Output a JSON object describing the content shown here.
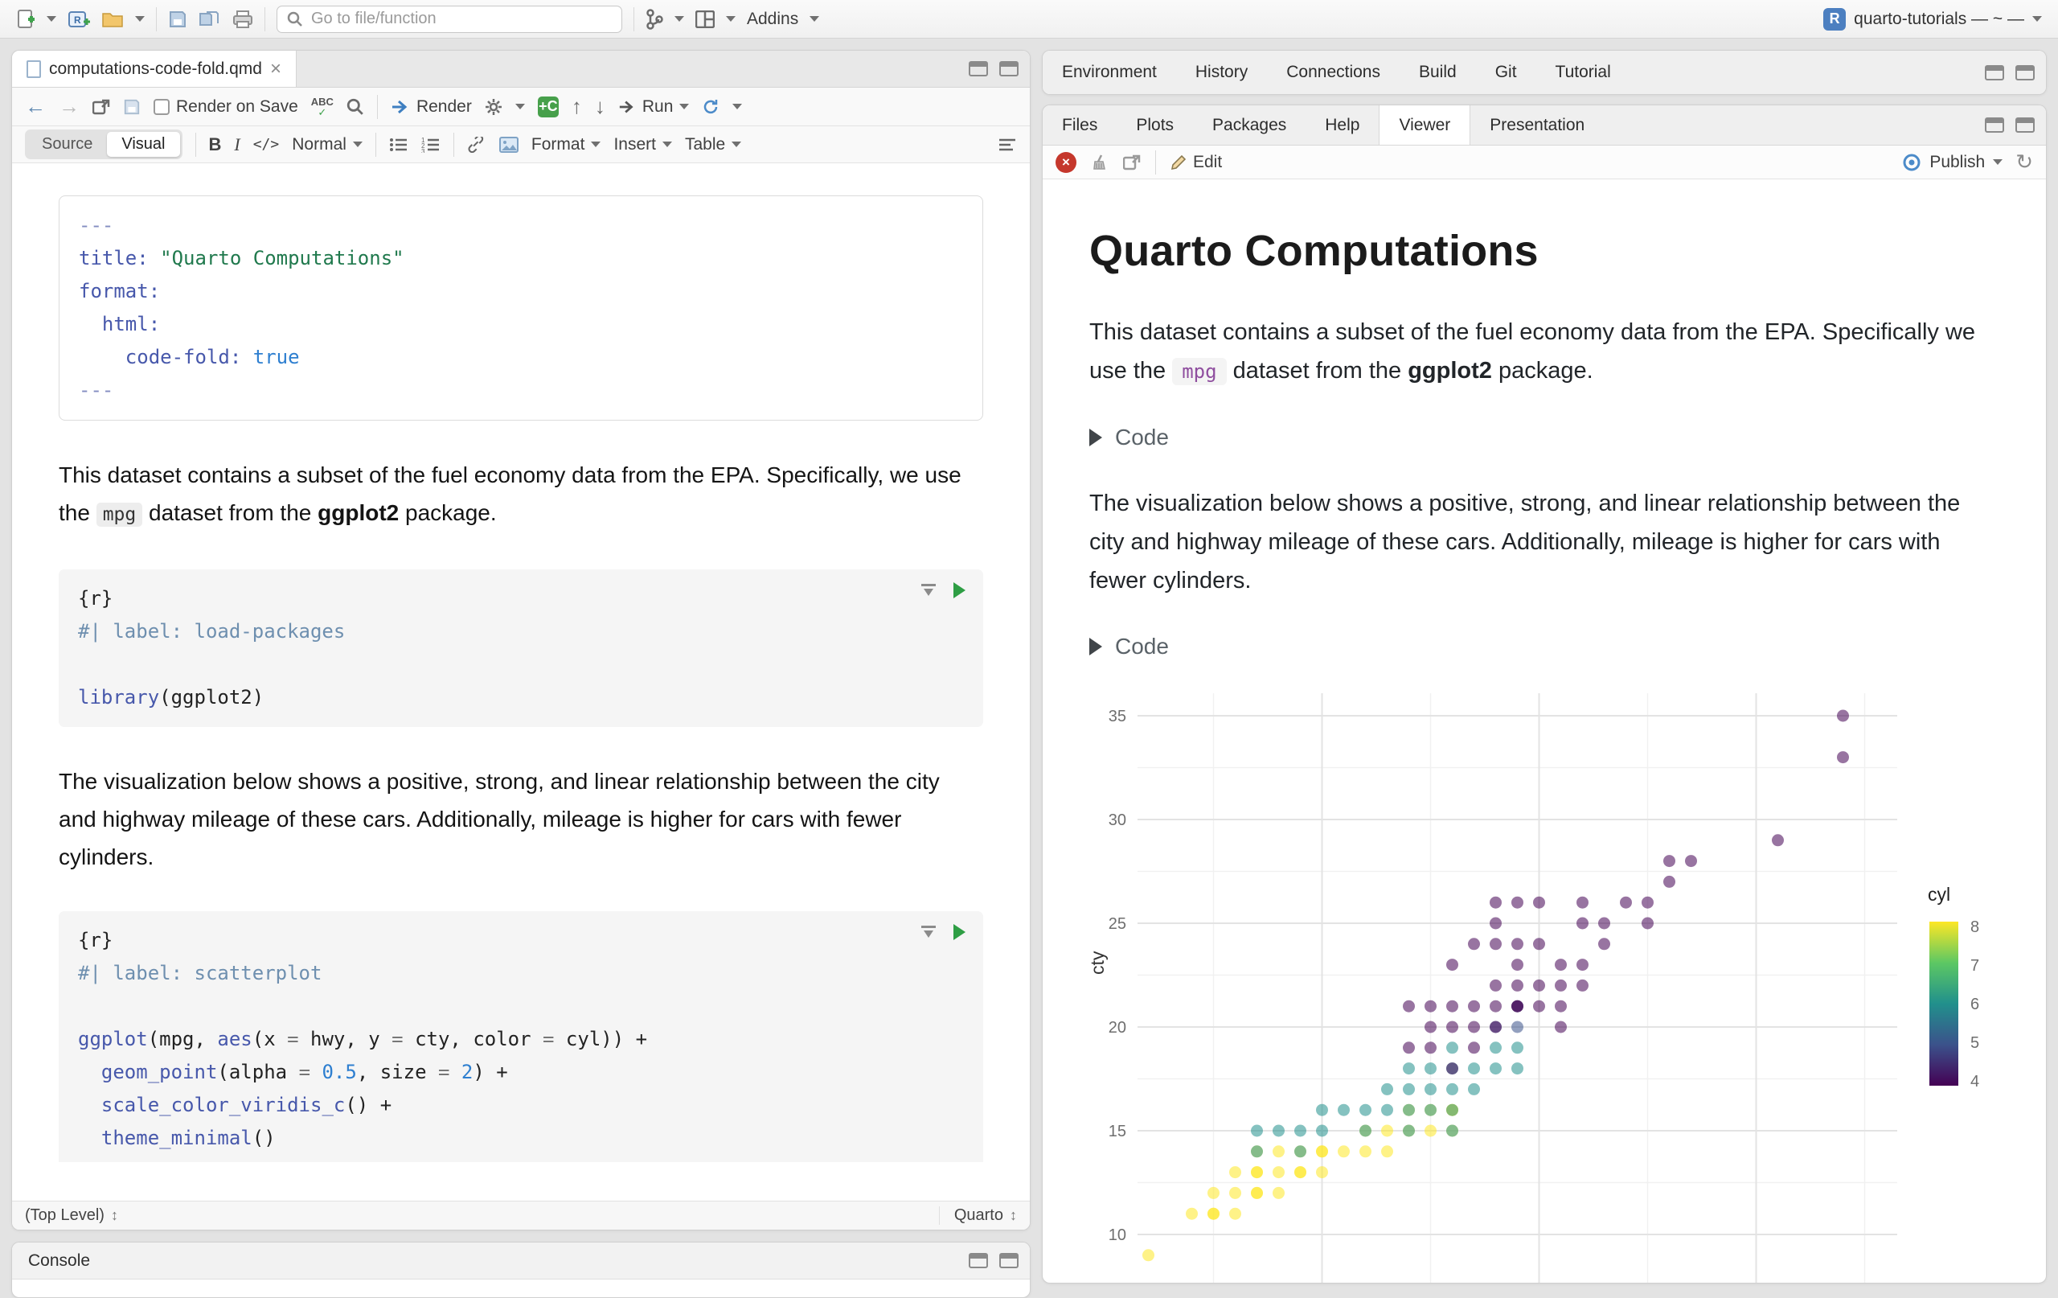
{
  "titlebar": {
    "goto_placeholder": "Go to file/function",
    "addins_label": "Addins",
    "project_label": "quarto-tutorials — ~ —"
  },
  "source_pane": {
    "tab_title": "computations-code-fold.qmd",
    "close_glyph": "×",
    "toolbar": {
      "render_on_save": "Render on Save",
      "render": "Render",
      "run": "Run"
    },
    "format_toolbar": {
      "source": "Source",
      "visual": "Visual",
      "bold": "B",
      "italic": "I",
      "code": "</>",
      "paragraph_style": "Normal",
      "format": "Format",
      "insert": "Insert",
      "table": "Table"
    },
    "yaml_lines": [
      [
        [
          "de",
          "---"
        ]
      ],
      [
        [
          "kw",
          "title:"
        ],
        [
          "pl",
          " "
        ],
        [
          "str",
          "\"Quarto Computations\""
        ]
      ],
      [
        [
          "kw",
          "format:"
        ]
      ],
      [
        [
          "pl",
          "  "
        ],
        [
          "kw",
          "html:"
        ]
      ],
      [
        [
          "pl",
          "    "
        ],
        [
          "kw",
          "code-fold:"
        ],
        [
          "pl",
          " "
        ],
        [
          "num",
          "true"
        ]
      ],
      [
        [
          "de",
          "---"
        ]
      ]
    ],
    "p1": {
      "a": "This dataset contains a subset of the fuel economy data from the EPA. Specifically, we use the ",
      "code": "mpg",
      "b": " dataset from the ",
      "bold": "ggplot2",
      "c": " package."
    },
    "chunk1_lines": [
      [
        [
          "pl",
          "{r}"
        ]
      ],
      [
        [
          "cm",
          "#| label: load-packages"
        ]
      ],
      [],
      [
        [
          "kw",
          "library"
        ],
        [
          "pl",
          "(ggplot2)"
        ]
      ]
    ],
    "p2": "The visualization below shows a positive, strong, and linear relationship between the city and highway mileage of these cars. Additionally, mileage is higher for cars with fewer cylinders.",
    "chunk2_lines": [
      [
        [
          "pl",
          "{r}"
        ]
      ],
      [
        [
          "cm",
          "#| label: scatterplot"
        ]
      ],
      [],
      [
        [
          "kw",
          "ggplot"
        ],
        [
          "pl",
          "(mpg, "
        ],
        [
          "kw",
          "aes"
        ],
        [
          "pl",
          "(x "
        ],
        [
          "op",
          "="
        ],
        [
          "pl",
          " hwy, y "
        ],
        [
          "op",
          "="
        ],
        [
          "pl",
          " cty, color "
        ],
        [
          "op",
          "="
        ],
        [
          "pl",
          " cyl)) +"
        ]
      ],
      [
        [
          "pl",
          "  "
        ],
        [
          "kw",
          "geom_point"
        ],
        [
          "pl",
          "(alpha "
        ],
        [
          "op",
          "="
        ],
        [
          "pl",
          " "
        ],
        [
          "num",
          "0.5"
        ],
        [
          "pl",
          ", size "
        ],
        [
          "op",
          "="
        ],
        [
          "pl",
          " "
        ],
        [
          "num",
          "2"
        ],
        [
          "pl",
          ") +"
        ]
      ],
      [
        [
          "pl",
          "  "
        ],
        [
          "kw",
          "scale_color_viridis_c"
        ],
        [
          "pl",
          "() +"
        ]
      ],
      [
        [
          "pl",
          "  "
        ],
        [
          "kw",
          "theme_minimal"
        ],
        [
          "pl",
          "()"
        ]
      ]
    ],
    "status_left": "(Top Level)",
    "status_right": "Quarto"
  },
  "console_pane": {
    "title": "Console"
  },
  "env_pane": {
    "tabs": [
      "Environment",
      "History",
      "Connections",
      "Build",
      "Git",
      "Tutorial"
    ]
  },
  "viewer_pane": {
    "tabs": [
      "Files",
      "Plots",
      "Packages",
      "Help",
      "Viewer",
      "Presentation"
    ],
    "active_tab": "Viewer",
    "toolbar": {
      "edit": "Edit",
      "publish": "Publish"
    }
  },
  "viewer": {
    "title": "Quarto Computations",
    "p1": {
      "a": "This dataset contains a subset of the fuel economy data from the EPA. Specifically we use the ",
      "code": "mpg",
      "b": " dataset from the ",
      "bold": "ggplot2",
      "c": " package."
    },
    "fold_label": "Code",
    "p2": "The visualization below shows a positive, strong, and linear relationship between the city and highway mileage of these cars. Additionally, mileage is higher for cars with fewer cylinders."
  },
  "chart_data": {
    "type": "scatter",
    "title": "",
    "xlabel": "",
    "ylabel": "cty",
    "x_field": "hwy",
    "color_field": "cyl",
    "point_alpha": 0.5,
    "x_major_gridlines": [
      20,
      30,
      40
    ],
    "x_minor_gridlines": [
      15,
      25,
      35,
      45
    ],
    "y_ticks": [
      10,
      15,
      20,
      25,
      30,
      35
    ],
    "y_minor_gridlines": [
      12.5,
      17.5,
      22.5,
      27.5,
      32.5
    ],
    "xlim": [
      11.5,
      46.5
    ],
    "ylim": [
      8.5,
      36.1
    ],
    "legend": {
      "title": "cyl",
      "tick_labels": [
        "8",
        "7",
        "6",
        "5",
        "4"
      ],
      "gradient_stops": [
        "#FDE725",
        "#5DC863",
        "#21908C",
        "#3B528B",
        "#440154"
      ]
    },
    "color_map": {
      "4": "#440154",
      "5": "#3B528B",
      "6": "#21908C",
      "7": "#5DC863",
      "8": "#FDE725"
    },
    "points": [
      [
        20,
        14,
        8
      ],
      [
        15,
        11,
        8
      ],
      [
        20,
        14,
        8
      ],
      [
        17,
        13,
        8
      ],
      [
        17,
        12,
        8
      ],
      [
        26,
        16,
        8
      ],
      [
        23,
        15,
        8
      ],
      [
        26,
        16,
        8
      ],
      [
        25,
        15,
        8
      ],
      [
        24,
        15,
        8
      ],
      [
        19,
        14,
        8
      ],
      [
        14,
        11,
        8
      ],
      [
        15,
        11,
        8
      ],
      [
        17,
        14,
        8
      ],
      [
        19,
        13,
        8
      ],
      [
        17,
        13,
        8
      ],
      [
        12,
        9,
        8
      ],
      [
        17,
        12,
        8
      ],
      [
        16,
        12,
        8
      ],
      [
        18,
        12,
        8
      ],
      [
        16,
        11,
        8
      ],
      [
        22,
        15,
        8
      ],
      [
        24,
        16,
        8
      ],
      [
        22,
        14,
        8
      ],
      [
        18,
        13,
        8
      ],
      [
        19,
        13,
        8
      ],
      [
        20,
        13,
        8
      ],
      [
        21,
        14,
        8
      ],
      [
        23,
        14,
        8
      ],
      [
        26,
        15,
        8
      ],
      [
        25,
        16,
        8
      ],
      [
        16,
        13,
        8
      ],
      [
        15,
        12,
        8
      ],
      [
        18,
        14,
        8
      ],
      [
        26,
        18,
        6
      ],
      [
        26,
        16,
        6
      ],
      [
        27,
        17,
        6
      ],
      [
        25,
        16,
        6
      ],
      [
        25,
        17,
        6
      ],
      [
        24,
        15,
        6
      ],
      [
        24,
        16,
        6
      ],
      [
        24,
        17,
        6
      ],
      [
        22,
        15,
        6
      ],
      [
        22,
        16,
        6
      ],
      [
        23,
        16,
        6
      ],
      [
        23,
        17,
        6
      ],
      [
        26,
        17,
        6
      ],
      [
        27,
        18,
        6
      ],
      [
        28,
        18,
        6
      ],
      [
        29,
        18,
        6
      ],
      [
        29,
        19,
        6
      ],
      [
        26,
        15,
        6
      ],
      [
        25,
        18,
        6
      ],
      [
        20,
        15,
        6
      ],
      [
        19,
        14,
        6
      ],
      [
        17,
        14,
        6
      ],
      [
        17,
        15,
        6
      ],
      [
        18,
        15,
        6
      ],
      [
        19,
        15,
        6
      ],
      [
        20,
        16,
        6
      ],
      [
        21,
        16,
        6
      ],
      [
        28,
        19,
        6
      ],
      [
        24,
        18,
        6
      ],
      [
        26,
        19,
        6
      ],
      [
        28,
        20,
        5
      ],
      [
        29,
        20,
        5
      ],
      [
        29,
        21,
        5
      ],
      [
        29,
        21,
        4
      ],
      [
        29,
        21,
        4
      ],
      [
        31,
        20,
        4
      ],
      [
        30,
        21,
        4
      ],
      [
        26,
        18,
        4
      ],
      [
        27,
        19,
        4
      ],
      [
        27,
        20,
        4
      ],
      [
        28,
        20,
        4
      ],
      [
        28,
        21,
        4
      ],
      [
        29,
        22,
        4
      ],
      [
        29,
        23,
        4
      ],
      [
        30,
        22,
        4
      ],
      [
        31,
        21,
        4
      ],
      [
        31,
        22,
        4
      ],
      [
        31,
        23,
        4
      ],
      [
        32,
        22,
        4
      ],
      [
        32,
        23,
        4
      ],
      [
        33,
        24,
        4
      ],
      [
        33,
        25,
        4
      ],
      [
        35,
        26,
        4
      ],
      [
        36,
        27,
        4
      ],
      [
        37,
        28,
        4
      ],
      [
        35,
        25,
        4
      ],
      [
        29,
        24,
        4
      ],
      [
        28,
        22,
        4
      ],
      [
        27,
        21,
        4
      ],
      [
        26,
        20,
        4
      ],
      [
        25,
        19,
        4
      ],
      [
        25,
        20,
        4
      ],
      [
        24,
        19,
        4
      ],
      [
        24,
        21,
        4
      ],
      [
        44,
        33,
        4
      ],
      [
        44,
        35,
        4
      ],
      [
        41,
        29,
        4
      ],
      [
        36,
        28,
        4
      ],
      [
        34,
        26,
        4
      ],
      [
        32,
        26,
        4
      ],
      [
        29,
        26,
        4
      ],
      [
        28,
        25,
        4
      ],
      [
        27,
        24,
        4
      ],
      [
        26,
        23,
        4
      ],
      [
        25,
        21,
        4
      ],
      [
        26,
        21,
        4
      ],
      [
        28,
        24,
        4
      ],
      [
        30,
        26,
        4
      ],
      [
        28,
        26,
        4
      ],
      [
        32,
        25,
        4
      ],
      [
        30,
        24,
        4
      ]
    ]
  }
}
